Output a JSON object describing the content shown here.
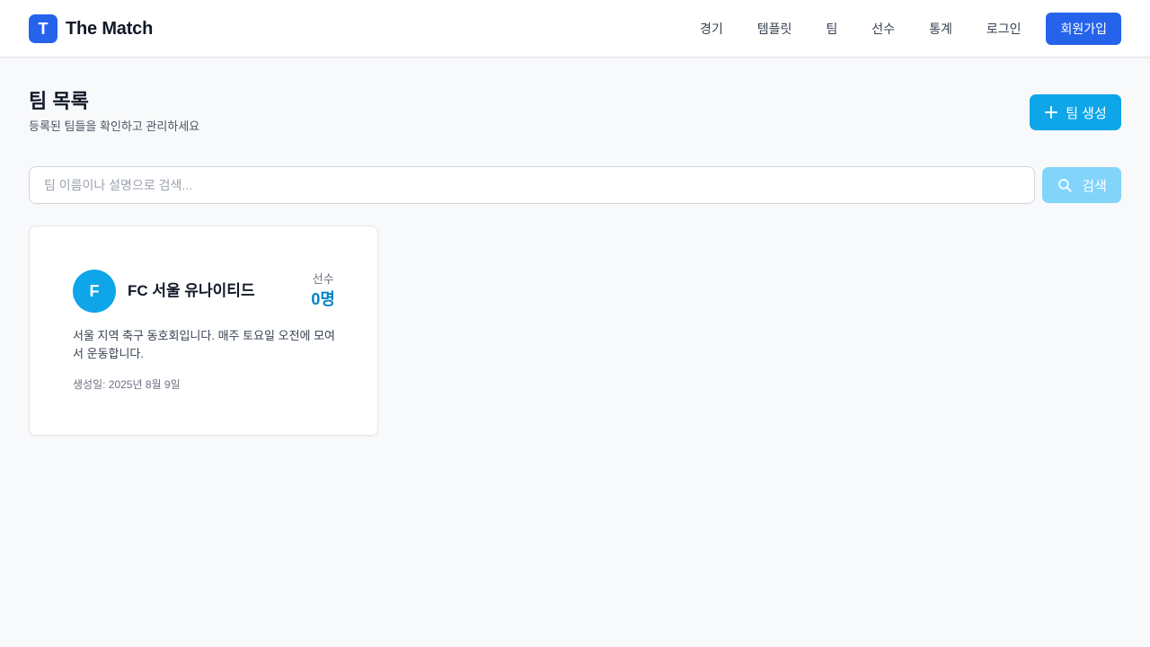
{
  "navbar": {
    "logo_letter": "T",
    "brand_name": "The Match",
    "links": [
      "경기",
      "템플릿",
      "팀",
      "선수",
      "통계",
      "로그인"
    ],
    "signup_label": "회원가입",
    "accent_color": "#2563eb"
  },
  "page": {
    "title": "팀 목록",
    "subtitle": "등록된 팀들을 확인하고 관리하세요",
    "create_button_label": "팀 생성",
    "create_button_icon": "plus-icon"
  },
  "search": {
    "placeholder": "팀 이름이나 설명으로 검색...",
    "value": "",
    "button_label": "검색",
    "button_icon": "search-icon"
  },
  "teams": [
    {
      "avatar_letter": "F",
      "name": "FC 서울 유나이티드",
      "players_label": "선수",
      "players_count": "0명",
      "description": "서울 지역 축구 동호회입니다. 매주 토요일 오전에 모여서 운동합니다.",
      "created": "생성일: 2025년 8월 9일"
    }
  ],
  "colors": {
    "primary": "#2563eb",
    "sky": "#0ea5e9",
    "sky_disabled": "#7dd3fc",
    "background": "#f8f9fb"
  }
}
